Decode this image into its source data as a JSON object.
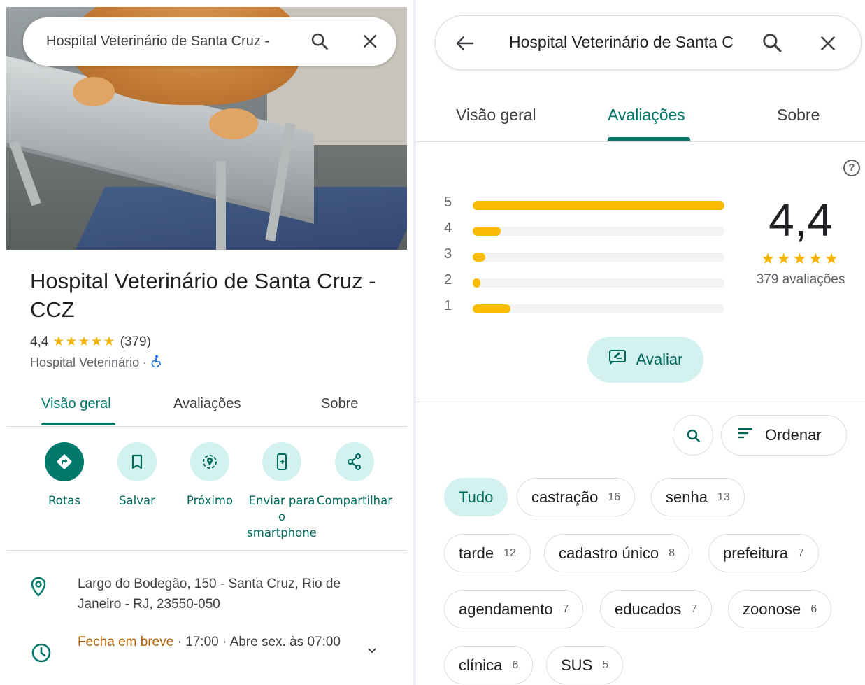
{
  "left": {
    "search": {
      "query": "Hospital Veterinário de Santa Cruz -"
    },
    "place": {
      "title": "Hospital Veterinário de Santa Cruz - CCZ",
      "rating": "4,4",
      "stars": "★★★★★",
      "review_count": "(379)",
      "category": "Hospital Veterinário ·"
    },
    "tabs": [
      "Visão geral",
      "Avaliações",
      "Sobre"
    ],
    "actions": [
      {
        "label": "Rotas",
        "icon": "directions-icon"
      },
      {
        "label": "Salvar",
        "icon": "bookmark-icon"
      },
      {
        "label": "Próximo",
        "icon": "nearby-icon"
      },
      {
        "label": "Enviar para o smartphone",
        "icon": "send-to-phone-icon"
      },
      {
        "label": "Compartilhar",
        "icon": "share-icon"
      }
    ],
    "address": "Largo do Bodegão, 150 - Santa Cruz, Rio de Janeiro - RJ, 23550-050",
    "hours": {
      "status": "Fecha em breve",
      "detail": " · 17:00 · Abre sex. às 07:00"
    }
  },
  "right": {
    "search": {
      "query": "Hospital Veterinário de Santa C"
    },
    "tabs": [
      "Visão geral",
      "Avaliações",
      "Sobre"
    ],
    "help_glyph": "?",
    "histogram": [
      {
        "stars": "5",
        "fraction": 1.0
      },
      {
        "stars": "4",
        "fraction": 0.11
      },
      {
        "stars": "3",
        "fraction": 0.05
      },
      {
        "stars": "2",
        "fraction": 0.025
      },
      {
        "stars": "1",
        "fraction": 0.15
      }
    ],
    "average": "4,4",
    "average_stars": "★★★★★",
    "total_reviews": "379 avaliações",
    "rate_button": "Avaliar",
    "sort_button": "Ordenar",
    "chips": [
      {
        "label": "Tudo",
        "count": ""
      },
      {
        "label": "castração",
        "count": "16"
      },
      {
        "label": "senha",
        "count": "13"
      },
      {
        "label": "tarde",
        "count": "12"
      },
      {
        "label": "cadastro único",
        "count": "8"
      },
      {
        "label": "prefeitura",
        "count": "7"
      },
      {
        "label": "agendamento",
        "count": "7"
      },
      {
        "label": "educados",
        "count": "7"
      },
      {
        "label": "zoonose",
        "count": "6"
      },
      {
        "label": "clínica",
        "count": "6"
      },
      {
        "label": "SUS",
        "count": "5"
      }
    ]
  },
  "colors": {
    "accent": "#00796b",
    "accent_light": "#d2f1ef",
    "star": "#f5b400",
    "bar": "#fbbc04",
    "closing": "#b06000"
  }
}
